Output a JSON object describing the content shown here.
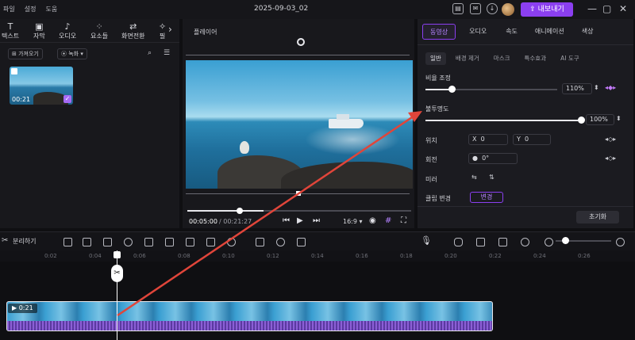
{
  "menu": [
    "파일",
    "설정",
    "도움"
  ],
  "window_title": "2025-09-03_02",
  "export_label": "내보내기",
  "left_tools": [
    {
      "label": "텍스트",
      "glyph": "T"
    },
    {
      "label": "자막",
      "glyph": "▣"
    },
    {
      "label": "오디오",
      "glyph": "♪"
    },
    {
      "label": "요소들",
      "glyph": "⁘"
    },
    {
      "label": "화면전환",
      "glyph": "⇄"
    },
    {
      "label": "필",
      "glyph": "✧"
    }
  ],
  "import_label": "가져오기",
  "record_label": "녹화",
  "media_duration": "00:21",
  "player_label": "플레이어",
  "time_current": "00:05:00",
  "time_total": "/ 00:21:27",
  "ratio": "16:9",
  "prop_tabs": [
    "동영상",
    "오디오",
    "속도",
    "애니메이션",
    "색상"
  ],
  "sub_tabs": [
    "일반",
    "배경 제거",
    "마스크",
    "특수효과",
    "AI 도구"
  ],
  "scale_label": "비율 조정",
  "scale_value": "110%",
  "scale_fraction": 0.2,
  "opacity_label": "불투명도",
  "opacity_value": "100%",
  "opacity_fraction": 1.0,
  "position_label": "위치",
  "pos_x_label": "X",
  "pos_x": "0",
  "pos_y_label": "Y",
  "pos_y": "0",
  "rotate_label": "회전",
  "rotate_value": "0°",
  "mirror_label": "미러",
  "clip_change_label": "클립 변경",
  "change_label": "변경",
  "reset_label": "초기화",
  "split_label": "분리하기",
  "ruler_ticks": [
    "0:02",
    "0:04",
    "0:06",
    "0:08",
    "0:10",
    "0:12",
    "0:14",
    "0:16",
    "0:18",
    "0:20",
    "0:22",
    "0:24",
    "0:26"
  ],
  "clip_duration": "0:21",
  "colors": {
    "accent": "#8b3ff0",
    "annotation_arrow": "#e0453a"
  }
}
